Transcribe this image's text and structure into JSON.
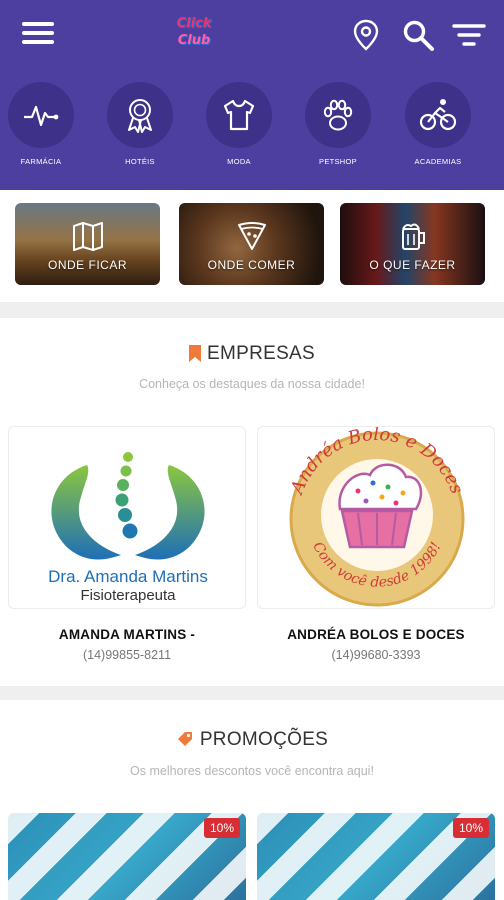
{
  "header": {
    "logo_alt_top": "Click",
    "logo_alt_bottom": "Club",
    "categories": [
      {
        "label": "FARMÁCIA",
        "icon": "heartbeat-icon"
      },
      {
        "label": "HOTÉIS",
        "icon": "award-ribbon-icon"
      },
      {
        "label": "MODA",
        "icon": "tshirt-icon"
      },
      {
        "label": "PETSHOP",
        "icon": "paw-icon"
      },
      {
        "label": "ACADEMIAS",
        "icon": "cyclist-icon"
      }
    ]
  },
  "features": [
    {
      "label": "ONDE FICAR",
      "icon": "map-icon"
    },
    {
      "label": "ONDE COMER",
      "icon": "pizza-icon"
    },
    {
      "label": "O QUE FAZER",
      "icon": "drink-icon"
    }
  ],
  "empresas": {
    "title": "EMPRESAS",
    "subtitle": "Conheça os destaques da nossa cidade!",
    "items": [
      {
        "name": "AMANDA MARTINS -",
        "phone": "(14)99855-8211",
        "logo_line1": "Dra. Amanda Martins",
        "logo_line2": "Fisioterapeuta"
      },
      {
        "name": "ANDRÉA BOLOS E DOCES",
        "phone": "(14)99680-3393",
        "logo_top": "Andréa Bolos e Doces",
        "logo_bottom": "Com você desde 1998!"
      }
    ]
  },
  "promocoes": {
    "title": "PROMOÇÕES",
    "subtitle": "Os melhores descontos você encontra aqui!",
    "items": [
      {
        "badge": "10%"
      },
      {
        "badge": "10%"
      }
    ]
  },
  "colors": {
    "header": "#4c3fa0",
    "circle": "#3d3189",
    "accent": "#f07a3a",
    "badge": "#d62e34"
  }
}
